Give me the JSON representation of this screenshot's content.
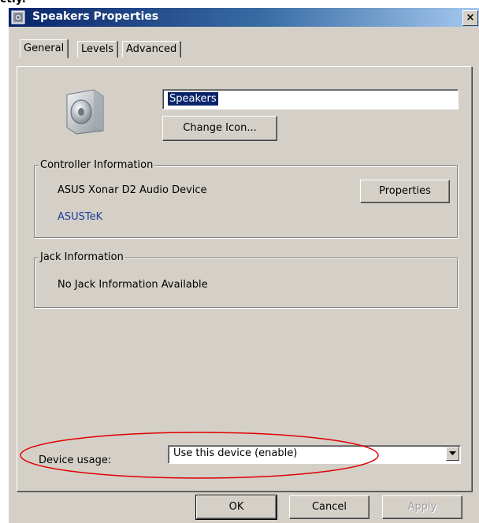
{
  "window": {
    "title": "Speakers Properties",
    "close_glyph": "×"
  },
  "tabs": [
    {
      "label": "General",
      "active": true
    },
    {
      "label": "Levels",
      "active": false
    },
    {
      "label": "Advanced",
      "active": false
    }
  ],
  "general": {
    "device_name": "Speakers",
    "change_icon_label": "Change Icon...",
    "controller": {
      "group_label": "Controller Information",
      "device": "ASUS Xonar D2 Audio Device",
      "manufacturer": "ASUSTeK",
      "properties_label": "Properties"
    },
    "jack": {
      "group_label": "Jack Information",
      "text": "No Jack Information Available"
    },
    "device_usage": {
      "label": "Device usage:",
      "value": "Use this device (enable)"
    }
  },
  "buttons": {
    "ok": "OK",
    "cancel": "Cancel",
    "apply": "Apply",
    "apply_enabled": false
  },
  "icons": {
    "title": "speaker-icon",
    "device": "speaker-icon",
    "close": "close-icon",
    "dropdown": "chevron-down-icon"
  },
  "colors": {
    "title_gradient_start": "#0a246a",
    "title_gradient_end": "#a6caf0",
    "dialog_bg": "#d4d0c8",
    "selection_bg": "#0a246a",
    "link_text": "#1e3c96",
    "annotation_ellipse": "#e00000"
  }
}
